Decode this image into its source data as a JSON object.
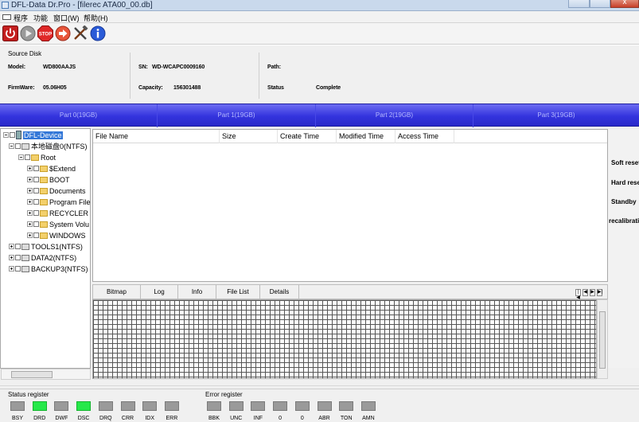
{
  "window": {
    "title": "DFL-Data Dr.Pro - [filerec ATA00_00.db]",
    "close_glyph": "x"
  },
  "menu": [
    {
      "label": "程序"
    },
    {
      "label": "功能"
    },
    {
      "label": "窗口(W)"
    },
    {
      "label": "帮助(H)"
    }
  ],
  "toolbar": [
    {
      "icon": "power-icon",
      "color": "#d22a2a"
    },
    {
      "icon": "play-icon",
      "color": "#8a8a8a"
    },
    {
      "icon": "stop-icon",
      "color": "#e03030",
      "label": "STOP"
    },
    {
      "icon": "forward-icon",
      "color": "#e25a3a"
    },
    {
      "icon": "tools-icon",
      "color": "#555555"
    },
    {
      "icon": "info-icon",
      "color": "#2a5bd8"
    }
  ],
  "source_disk": {
    "title": "Source Disk",
    "model_label": "Model:",
    "model": "WD800AAJS",
    "sn_label": "SN:",
    "sn": "WD-WCAPC0009160",
    "path_label": "Path:",
    "path": "",
    "firmware_label": "FirmWare:",
    "firmware": "05.06H05",
    "capacity_label": "Capacity:",
    "capacity": "156301488",
    "status_label": "Status",
    "status": "Complete"
  },
  "partitions": [
    {
      "label": "Part 0(19GB)"
    },
    {
      "label": "Part 1(19GB)"
    },
    {
      "label": "Part 2(19GB)"
    },
    {
      "label": "Part 3(19GB)"
    }
  ],
  "tree": [
    {
      "label": "DFL-Device"
    },
    {
      "label": "本地磁盘0(NTFS)"
    },
    {
      "label": "Root"
    },
    {
      "label": "$Extend"
    },
    {
      "label": "BOOT"
    },
    {
      "label": "Documents"
    },
    {
      "label": "Program File"
    },
    {
      "label": "RECYCLER"
    },
    {
      "label": "System Volu"
    },
    {
      "label": "WINDOWS"
    },
    {
      "label": "TOOLS1(NTFS)"
    },
    {
      "label": "DATA2(NTFS)"
    },
    {
      "label": "BACKUP3(NTFS)"
    }
  ],
  "file_list": {
    "columns": [
      {
        "label": "File Name"
      },
      {
        "label": "Size"
      },
      {
        "label": "Create Time"
      },
      {
        "label": "Modified Time"
      },
      {
        "label": "Access Time"
      }
    ]
  },
  "right_panel": [
    {
      "label": "Soft reset"
    },
    {
      "label": "Hard rese"
    },
    {
      "label": "Standby"
    },
    {
      "label": "recalibratio"
    }
  ],
  "tabs": [
    {
      "label": "Bitmap"
    },
    {
      "label": "Log"
    },
    {
      "label": "Info"
    },
    {
      "label": "File List"
    },
    {
      "label": "Details"
    }
  ],
  "nav": [
    "|◀",
    "◀",
    "▶",
    "▶|"
  ],
  "status_register": {
    "title": "Status register",
    "bits": [
      {
        "label": "BSY",
        "on": false
      },
      {
        "label": "DRD",
        "on": true
      },
      {
        "label": "DWF",
        "on": false
      },
      {
        "label": "DSC",
        "on": true
      },
      {
        "label": "DRQ",
        "on": false
      },
      {
        "label": "CRR",
        "on": false
      },
      {
        "label": "IDX",
        "on": false
      },
      {
        "label": "ERR",
        "on": false
      }
    ]
  },
  "error_register": {
    "title": "Error register",
    "bits": [
      {
        "label": "BBK",
        "on": false
      },
      {
        "label": "UNC",
        "on": false
      },
      {
        "label": "INF",
        "on": false
      },
      {
        "label": "0",
        "on": false
      },
      {
        "label": "0",
        "on": false
      },
      {
        "label": "ABR",
        "on": false
      },
      {
        "label": "TON",
        "on": false
      },
      {
        "label": "AMN",
        "on": false
      }
    ]
  }
}
